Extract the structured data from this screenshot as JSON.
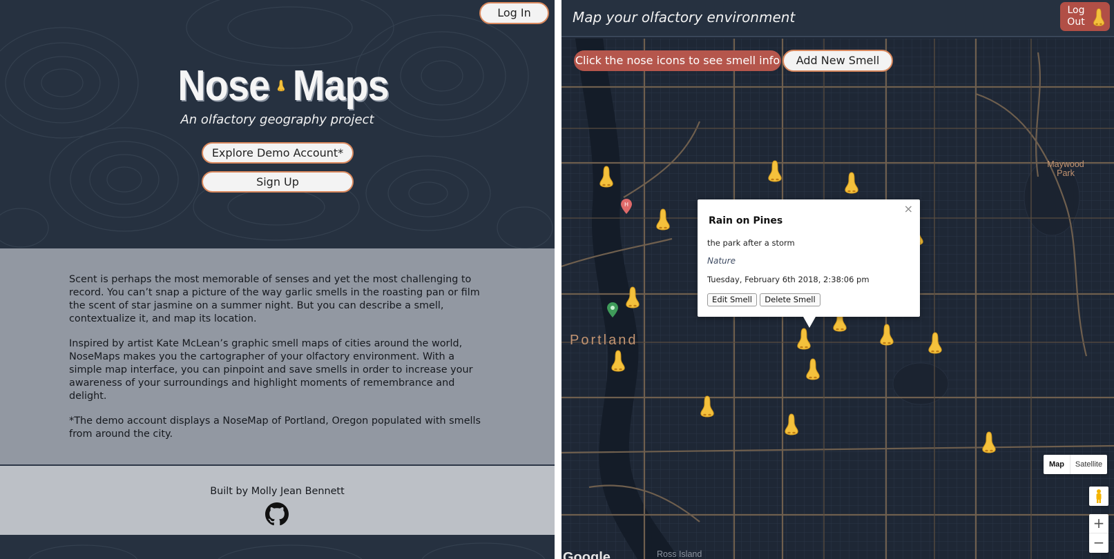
{
  "landing": {
    "login_label": "Log In",
    "title_left": "Nose",
    "title_right": "Maps",
    "title_icon": "nose-icon",
    "subtitle": "An olfactory geography project",
    "demo_label": "Explore Demo Account*",
    "signup_label": "Sign Up",
    "about": {
      "p1": "Scent is perhaps the most memorable of senses and yet the most challenging to record. You can’t snap a picture of the way garlic smells in the roasting pan or film the scent of star jasmine on a summer night. But you can describe a smell, contextualize it, and map its location.",
      "p2": "Inspired by artist Kate McLean’s graphic smell maps of cities around the world, NoseMaps makes you the cartographer of your olfactory environment. With a simple map interface, you can pinpoint and save smells in order to increase your awareness of your surroundings and highlight moments of remembrance and delight.",
      "p3": "*The demo account displays a NoseMap of Portland, Oregon populated with smells from around the city."
    },
    "footer": {
      "credit": "Built by Molly Jean Bennett",
      "icon": "github-icon"
    }
  },
  "app": {
    "title": "Map your olfactory environment",
    "logout_label": "Log Out",
    "hint": "Click the nose icons to see smell info",
    "add_label": "Add New Smell",
    "map_labels": {
      "portland": "Portland",
      "maywood": "Maywood Park",
      "ross_island": "Ross Island",
      "google": "Google"
    },
    "info_window": {
      "title": "Rain on Pines",
      "description": "the park after a storm",
      "category": "Nature",
      "date": "Tuesday, February 6th 2018, 2:38:06 pm",
      "edit_label": "Edit Smell",
      "delete_label": "Delete Smell",
      "close_glyph": "×"
    },
    "map_type": {
      "map_label": "Map",
      "satellite_label": "Satellite"
    },
    "zoom": {
      "in_glyph": "+",
      "out_glyph": "−"
    }
  },
  "colors": {
    "background_dark": "#263140",
    "accent_orange": "#d9885d",
    "hint_red": "#b5564c",
    "logout_red": "#b14f46",
    "nose_yellow": "#f4c13c",
    "map_road": "#7d6a55"
  }
}
